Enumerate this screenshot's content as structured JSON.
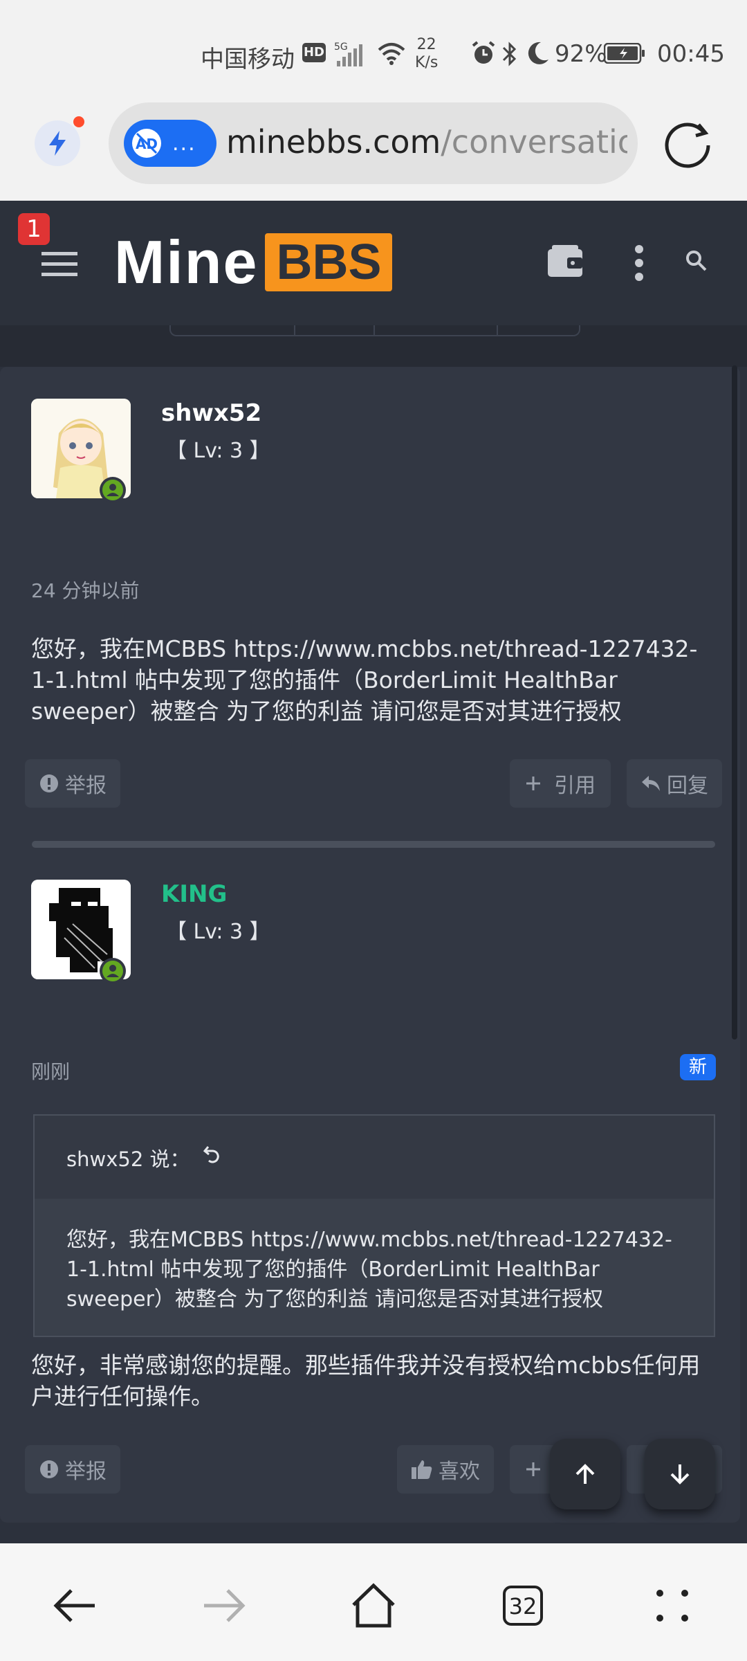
{
  "status_bar": {
    "carrier": "中国移动",
    "hd": "HD",
    "net_speed_value": "22",
    "net_speed_unit": "K/s",
    "battery_percent": "92%",
    "time": "00:45"
  },
  "browser": {
    "ad_pill_dots": "...",
    "url_host": "minebbs.com",
    "url_path": "/conversation"
  },
  "site": {
    "notification_count": "1",
    "logo_part1": "Mine",
    "logo_part2": "BBS"
  },
  "messages": [
    {
      "username": "shwx52",
      "level": "【 Lv: 3 】",
      "time": "24 分钟以前",
      "body": "您好，我在MCBBS https://www.mcbbs.net/thread-1227432-1-1.html 帖中发现了您的插件（BorderLimit HealthBar sweeper）被整合 为了您的利益 请问您是否对其进行授权",
      "report_label": "举报",
      "quote_label": "引用",
      "reply_label": "回复"
    },
    {
      "username": "KING",
      "level": "【 Lv: 3 】",
      "time": "刚刚",
      "new_tag": "新",
      "quote": {
        "author": "shwx52 说：",
        "body": "您好，我在MCBBS https://www.mcbbs.net/thread-1227432-1-1.html 帖中发现了您的插件（BorderLimit HealthBar sweeper）被整合 为了您的利益 请问您是否对其进行授权"
      },
      "body": "您好，非常感谢您的提醒。那些插件我并没有授权给mcbbs任何用户进行任何操作。",
      "report_label": "举报",
      "like_label": "喜欢"
    }
  ],
  "bottom_nav": {
    "tab_count": "32"
  },
  "colors": {
    "accent_blue": "#1c6ef3",
    "brand_orange": "#f7941d",
    "online_green": "#63a821",
    "username_green": "#22c08a"
  },
  "icons": [
    "signal-icon",
    "wifi-icon",
    "alarm-icon",
    "bluetooth-icon",
    "moon-icon",
    "battery-icon",
    "bolt-icon",
    "adblock-icon",
    "reload-icon",
    "hamburger-icon",
    "wallet-icon",
    "more-vertical-icon",
    "search-icon",
    "warning-icon",
    "plus-icon",
    "reply-icon",
    "thumbs-up-icon",
    "arrow-up-icon",
    "arrow-down-icon",
    "back-icon",
    "forward-icon",
    "home-icon",
    "tabs-icon",
    "menu-dots-icon"
  ]
}
